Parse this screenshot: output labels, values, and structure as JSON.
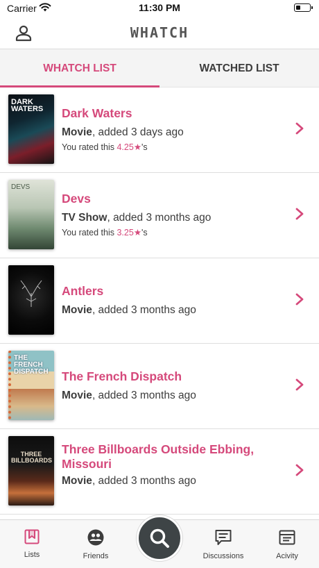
{
  "status_bar": {
    "carrier": "Carrier",
    "time": "11:30 PM",
    "battery_level": 0.35
  },
  "header": {
    "title": "WHATCH",
    "profile_icon": "person-icon"
  },
  "tabs": [
    {
      "label": "WHATCH LIST",
      "active": true
    },
    {
      "label": "WATCHED LIST",
      "active": false
    }
  ],
  "items": [
    {
      "title": "Dark Waters",
      "type": "Movie",
      "added": ", added 3 days ago",
      "rating_prefix": "You rated this ",
      "rating_value": "4.25",
      "rating_star": "★",
      "rating_suffix": "'s",
      "poster_text": "DARK WATERS"
    },
    {
      "title": "Devs",
      "type": "TV Show",
      "added": ", added 3 months ago",
      "rating_prefix": "You rated this ",
      "rating_value": "3.25",
      "rating_star": "★",
      "rating_suffix": "'s",
      "poster_text": "DEVS"
    },
    {
      "title": "Antlers",
      "type": "Movie",
      "added": ", added 3 months ago"
    },
    {
      "title": "The French Dispatch",
      "type": "Movie",
      "added": ", added 3 months ago",
      "poster_text": "THE FRENCH DISPATCH"
    },
    {
      "title": "Three Billboards Outside Ebbing, Missouri",
      "type": "Movie",
      "added": ", added 3 months ago",
      "poster_text": "THREE BILLBOARDS"
    }
  ],
  "tab_bar": {
    "lists": "Lists",
    "friends": "Friends",
    "discussions": "Discussions",
    "activity": "Acivity"
  },
  "colors": {
    "accent": "#d5497b",
    "text": "#3c3c3c",
    "fab": "#3e4446"
  }
}
